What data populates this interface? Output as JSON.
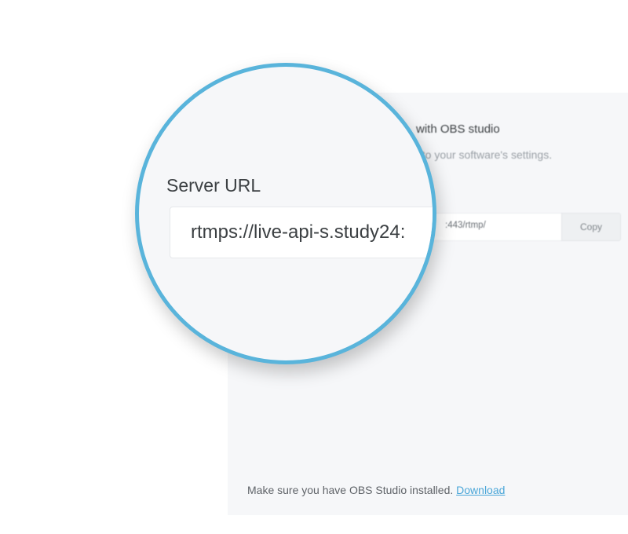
{
  "panel": {
    "heading": "with OBS studio",
    "subtext": "nto your software's settings.",
    "server_url_visible": ":443/rtmp/",
    "copy_label": "Copy",
    "footer_text": "Make sure you have OBS Studio installed.",
    "download_link": "Download"
  },
  "magnifier": {
    "label": "Server URL",
    "server_url_value": "rtmps://live-api-s.study24:"
  },
  "colors": {
    "accent_ring": "#59b4db",
    "link": "#4aa6d8",
    "panel_bg": "#f6f7f9"
  }
}
